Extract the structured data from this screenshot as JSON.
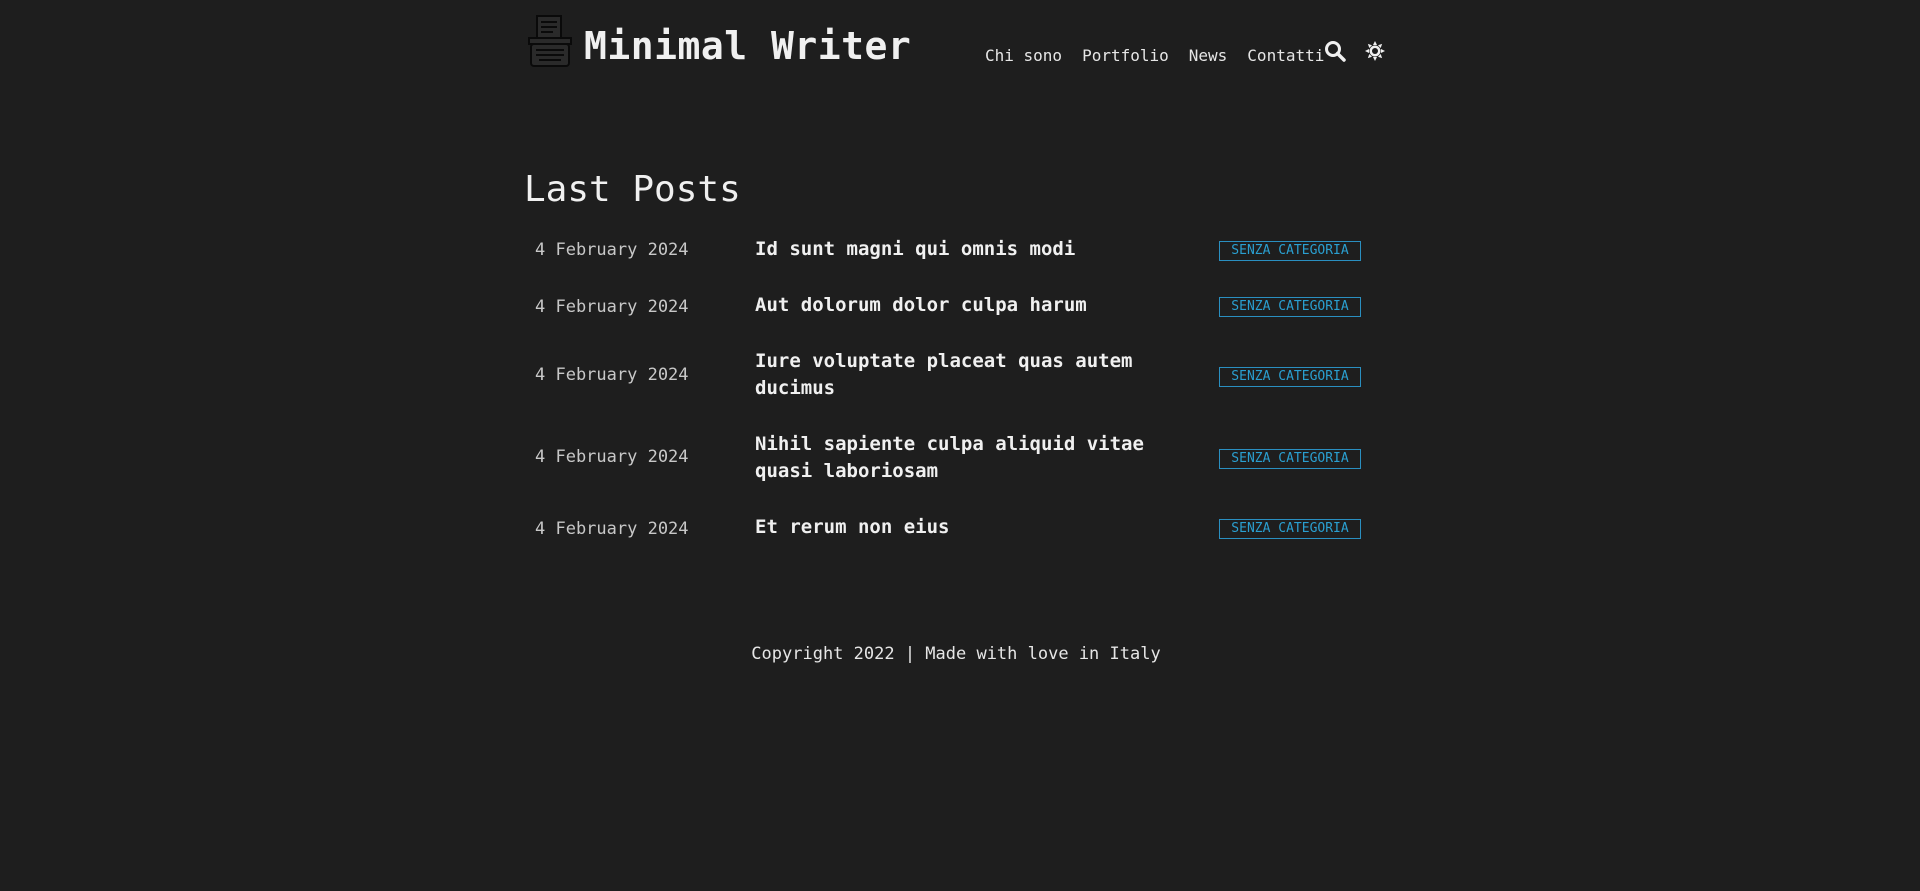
{
  "header": {
    "site_title": "Minimal Writer",
    "logo_icon": "typewriter-icon",
    "nav": [
      {
        "label": "Chi sono"
      },
      {
        "label": "Portfolio"
      },
      {
        "label": "News"
      },
      {
        "label": "Contatti"
      }
    ],
    "search_icon": "search-icon",
    "theme_icon": "sun-icon"
  },
  "main": {
    "section_title": "Last Posts",
    "posts": [
      {
        "date": "4 February 2024",
        "title": "Id sunt magni qui omnis modi",
        "category": "SENZA CATEGORIA"
      },
      {
        "date": "4 February 2024",
        "title": "Aut dolorum dolor culpa harum",
        "category": "SENZA CATEGORIA"
      },
      {
        "date": "4 February 2024",
        "title": "Iure voluptate placeat quas autem ducimus",
        "category": "SENZA CATEGORIA"
      },
      {
        "date": "4 February 2024",
        "title": "Nihil sapiente culpa aliquid vitae quasi laboriosam",
        "category": "SENZA CATEGORIA"
      },
      {
        "date": "4 February 2024",
        "title": "Et rerum non eius",
        "category": "SENZA CATEGORIA"
      }
    ]
  },
  "footer": {
    "text": "Copyright 2022 | Made with love in Italy"
  },
  "colors": {
    "background": "#1e1e1e",
    "text": "#e6e6e6",
    "accent": "#2a9fd0"
  }
}
